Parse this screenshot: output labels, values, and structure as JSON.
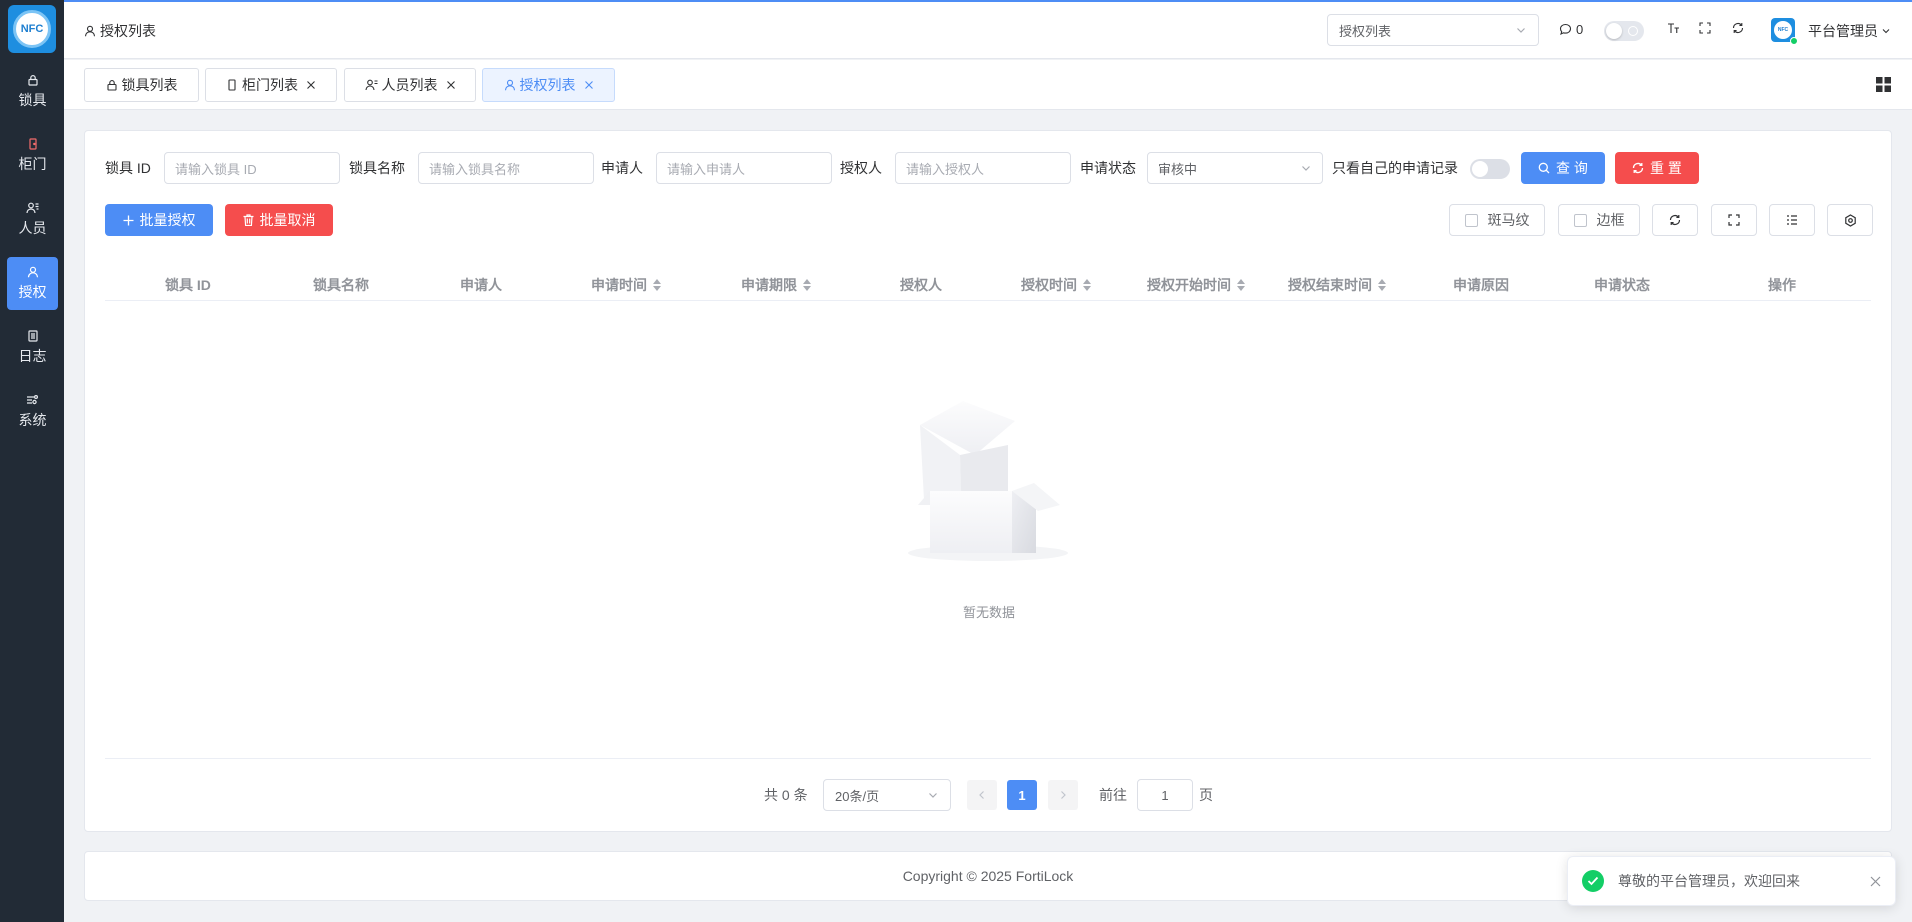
{
  "app": {
    "logo_text": "NFC"
  },
  "sidebar": {
    "items": [
      {
        "label": "锁具",
        "icon": "lock-icon"
      },
      {
        "label": "柜门",
        "icon": "cabinet-door-icon"
      },
      {
        "label": "人员",
        "icon": "users-icon"
      },
      {
        "label": "授权",
        "icon": "user-icon",
        "active": true
      },
      {
        "label": "日志",
        "icon": "log-icon"
      },
      {
        "label": "系统",
        "icon": "settings-sliders-icon"
      }
    ]
  },
  "header": {
    "breadcrumb": "授权列表",
    "menu_search_value": "授权列表",
    "message_count": "0",
    "user_name": "平台管理员",
    "avatar_text": "NFC"
  },
  "tabs": [
    {
      "label": "锁具列表",
      "closable": false,
      "active": false
    },
    {
      "label": "柜门列表",
      "closable": true,
      "active": false
    },
    {
      "label": "人员列表",
      "closable": true,
      "active": false
    },
    {
      "label": "授权列表",
      "closable": true,
      "active": true
    }
  ],
  "filters": {
    "lock_id": {
      "label": "锁具 ID",
      "placeholder": "请输入锁具 ID"
    },
    "lock_name": {
      "label": "锁具名称",
      "placeholder": "请输入锁具名称"
    },
    "applicant": {
      "label": "申请人",
      "placeholder": "请输入申请人"
    },
    "authorizer": {
      "label": "授权人",
      "placeholder": "请输入授权人"
    },
    "status": {
      "label": "申请状态",
      "value": "审核中"
    },
    "only_mine": {
      "label": "只看自己的申请记录"
    },
    "query_label": "查 询",
    "reset_label": "重 置"
  },
  "toolbar": {
    "batch_authorize": "批量授权",
    "batch_cancel": "批量取消",
    "stripe_label": "斑马纹",
    "border_label": "边框"
  },
  "table": {
    "columns": [
      {
        "label": "锁具 ID",
        "sortable": false
      },
      {
        "label": "锁具名称",
        "sortable": false
      },
      {
        "label": "申请人",
        "sortable": false
      },
      {
        "label": "申请时间",
        "sortable": true
      },
      {
        "label": "申请期限",
        "sortable": true
      },
      {
        "label": "授权人",
        "sortable": false
      },
      {
        "label": "授权时间",
        "sortable": true
      },
      {
        "label": "授权开始时间",
        "sortable": true
      },
      {
        "label": "授权结束时间",
        "sortable": true
      },
      {
        "label": "申请原因",
        "sortable": false
      },
      {
        "label": "申请状态",
        "sortable": false
      },
      {
        "label": "操作",
        "sortable": false
      }
    ],
    "rows": [],
    "empty_text": "暂无数据"
  },
  "pagination": {
    "total_text": "共 0 条",
    "page_size": "20条/页",
    "current_page": "1",
    "goto_label": "前往",
    "goto_value": "1",
    "page_suffix": "页"
  },
  "footer": {
    "copyright": "Copyright © 2025 FortiLock"
  },
  "notification": {
    "message": "尊敬的平台管理员，欢迎回来"
  },
  "colors": {
    "primary": "#4d8df5",
    "danger": "#f54d4d",
    "sidebar": "#222b36",
    "success": "#13ce66"
  }
}
